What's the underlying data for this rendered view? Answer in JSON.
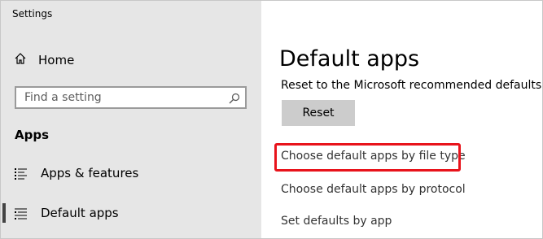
{
  "window": {
    "title": "Settings"
  },
  "sidebar": {
    "home_label": "Home",
    "search": {
      "placeholder": "Find a setting"
    },
    "section_title": "Apps",
    "items": [
      {
        "label": "Apps & features",
        "icon": "list-icon",
        "selected": false
      },
      {
        "label": "Default apps",
        "icon": "list-icon",
        "selected": true
      }
    ]
  },
  "main": {
    "title": "Default apps",
    "reset_description": "Reset to the Microsoft recommended defaults",
    "reset_button": "Reset",
    "links": [
      "Choose default apps by file type",
      "Choose default apps by protocol",
      "Set defaults by app"
    ]
  },
  "colors": {
    "sidebar_bg": "#e6e6e6",
    "button_bg": "#cccccc",
    "highlight": "#e8131b"
  }
}
